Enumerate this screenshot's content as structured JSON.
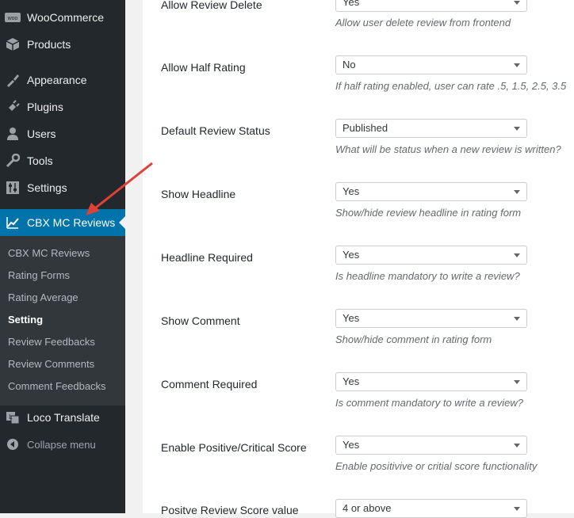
{
  "sidebar": {
    "menu": [
      {
        "label": "WooCommerce",
        "icon": "woocommerce-icon"
      },
      {
        "label": "Products",
        "icon": "products-icon"
      },
      {
        "label": "Appearance",
        "icon": "appearance-icon"
      },
      {
        "label": "Plugins",
        "icon": "plugins-icon"
      },
      {
        "label": "Users",
        "icon": "users-icon"
      },
      {
        "label": "Tools",
        "icon": "tools-icon"
      },
      {
        "label": "Settings",
        "icon": "settings-icon"
      },
      {
        "label": "CBX MC Reviews",
        "icon": "chart-icon",
        "active": true
      }
    ],
    "submenu": [
      {
        "label": "CBX MC Reviews"
      },
      {
        "label": "Rating Forms"
      },
      {
        "label": "Rating Average"
      },
      {
        "label": "Setting",
        "current": true
      },
      {
        "label": "Review Feedbacks"
      },
      {
        "label": "Review Comments"
      },
      {
        "label": "Comment Feedbacks"
      }
    ],
    "loco": {
      "label": "Loco Translate",
      "icon": "translate-icon"
    },
    "collapse": {
      "label": "Collapse menu",
      "icon": "collapse-icon"
    }
  },
  "settings": [
    {
      "label": "Allow Review Delete",
      "value": "Yes",
      "desc": "Allow user delete review from frontend"
    },
    {
      "label": "Allow Half Rating",
      "value": "No",
      "desc": "If half rating enabled, user can rate .5, 1.5, 2.5, 3.5"
    },
    {
      "label": "Default Review Status",
      "value": "Published",
      "desc": "What will be status when a new review is written?"
    },
    {
      "label": "Show Headline",
      "value": "Yes",
      "desc": "Show/hide review headline in rating form"
    },
    {
      "label": "Headline Required",
      "value": "Yes",
      "desc": "Is headline mandatory to write a review?"
    },
    {
      "label": "Show Comment",
      "value": "Yes",
      "desc": "Show/hide comment in rating form"
    },
    {
      "label": "Comment Required",
      "value": "Yes",
      "desc": "Is comment mandatory to write a review?"
    },
    {
      "label": "Enable Positive/Critical Score",
      "value": "Yes",
      "desc": "Enable positivive or critial score functionality"
    },
    {
      "label": "Positve Review Score value",
      "value": "4 or above",
      "desc": ""
    }
  ],
  "colors": {
    "active": "#0073aa",
    "sidebar": "#23282d",
    "annotation_arrow": "#e0403a"
  }
}
